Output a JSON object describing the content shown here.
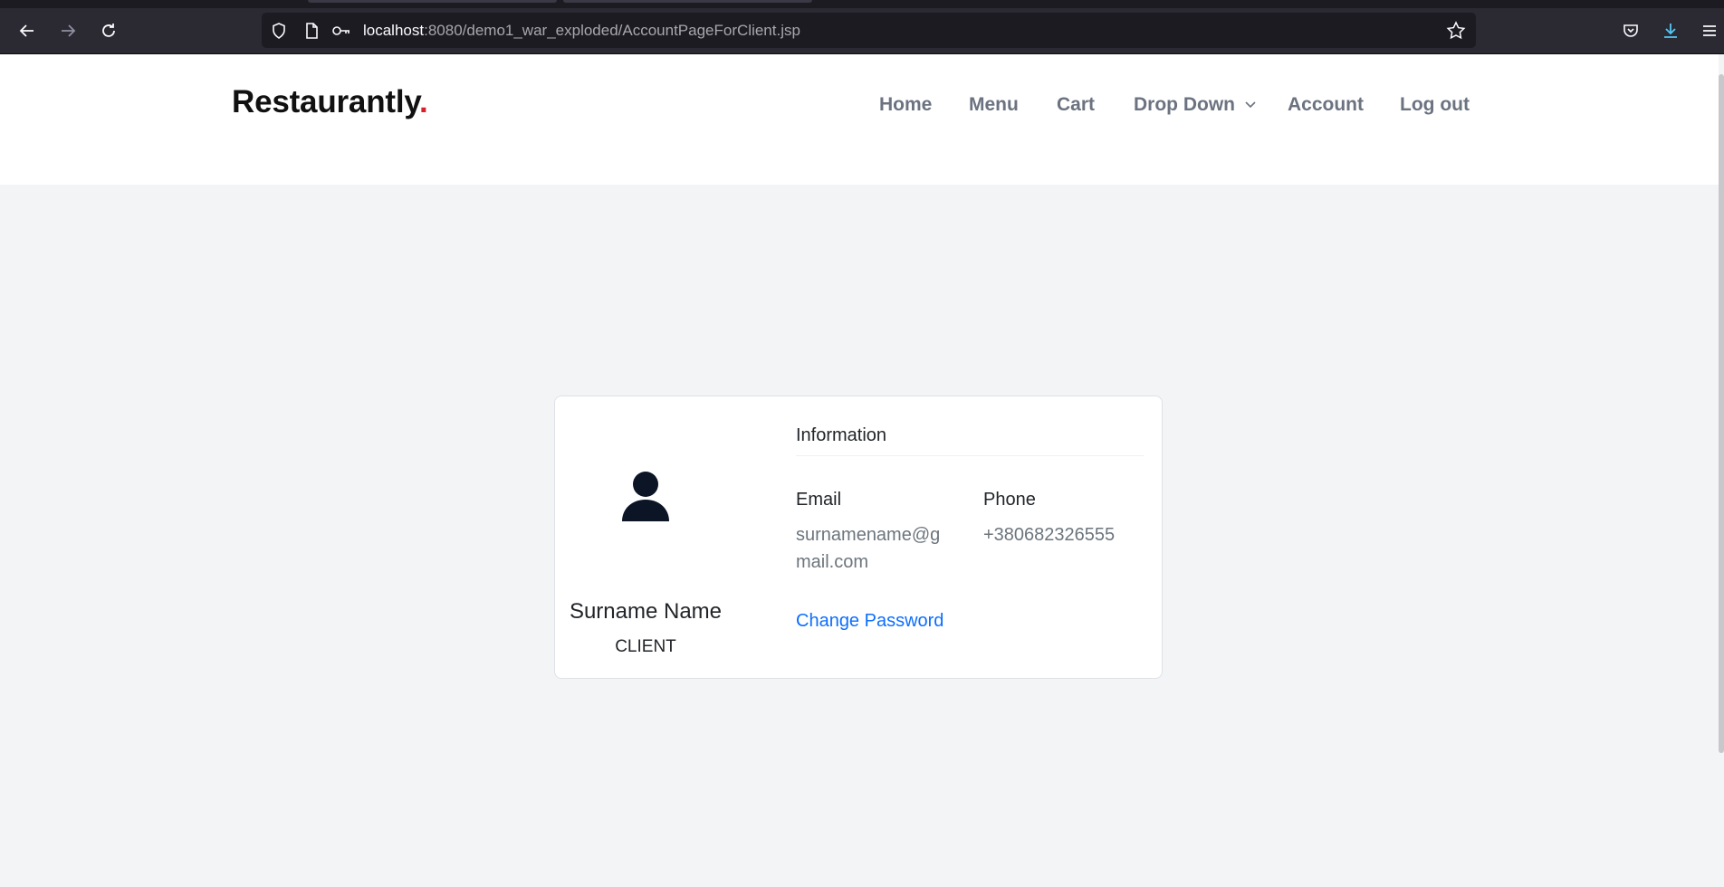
{
  "browser": {
    "url_host": "localhost",
    "url_rest": ":8080/demo1_war_exploded/AccountPageForClient.jsp"
  },
  "site": {
    "brand": "Restaurantly",
    "brand_dot": ".",
    "nav": {
      "home": "Home",
      "menu": "Menu",
      "cart": "Cart",
      "dropdown": "Drop Down",
      "account": "Account",
      "logout": "Log out"
    }
  },
  "profile": {
    "full_name": "Surname Name",
    "role": "CLIENT",
    "info_heading": "Information",
    "email_label": "Email",
    "email_value": "surnamename@gmail.com",
    "phone_label": "Phone",
    "phone_value": "+380682326555",
    "change_password": "Change Password"
  },
  "colors": {
    "brand_accent": "#d6202a",
    "link": "#0d6efd",
    "nav_text": "#6b7280",
    "page_bg": "#f3f4f6"
  }
}
